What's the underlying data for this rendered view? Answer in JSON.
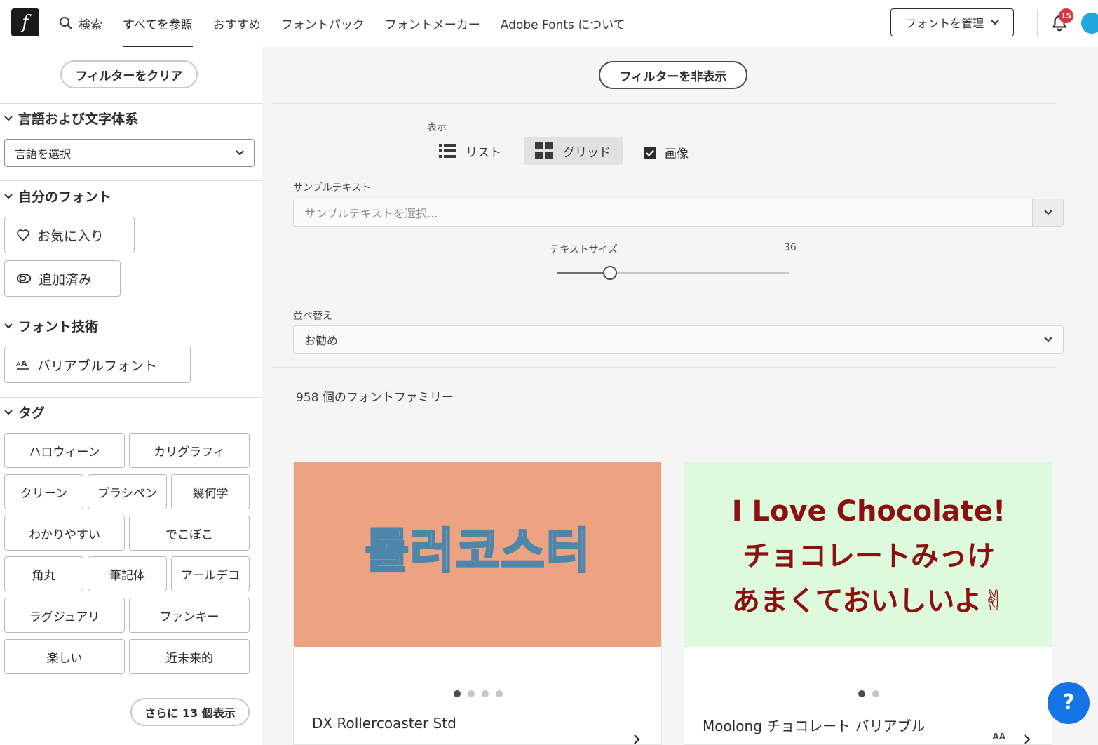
{
  "header": {
    "logo_glyph": "f",
    "nav": {
      "search": "検索",
      "browse_all": "すべてを参照",
      "recommended": "おすすめ",
      "font_packs": "フォントパック",
      "foundries": "フォントメーカー",
      "about": "Adobe Fonts について"
    },
    "manage_fonts": "フォントを管理",
    "notification_count": "15"
  },
  "sidebar": {
    "clear_filters": "フィルターをクリア",
    "language_section": {
      "title": "言語および文字体系",
      "select_value": "言語を選択"
    },
    "my_fonts_section": {
      "title": "自分のフォント",
      "favorites": "お気に入り",
      "added": "追加済み"
    },
    "tech_section": {
      "title": "フォント技術",
      "variable": "バリアブルフォント"
    },
    "tags_section": {
      "title": "タグ",
      "tags": [
        "ハロウィーン",
        "カリグラフィ",
        "クリーン",
        "ブラシペン",
        "幾何学",
        "わかりやすい",
        "でこぼこ",
        "角丸",
        "筆記体",
        "アールデコ",
        "ラグジュアリ",
        "ファンキー",
        "楽しい",
        "近未来的"
      ],
      "show_more": "さらに 13 個表示"
    }
  },
  "main": {
    "hide_filters": "フィルターを非表示",
    "view_label": "表示",
    "view_list": "リスト",
    "view_grid": "グリッド",
    "view_selected": "grid",
    "images_label": "画像",
    "images_checked": true,
    "sample_text_label": "サンプルテキスト",
    "sample_text_placeholder": "サンプルテキストを選択...",
    "text_size_label": "テキストサイズ",
    "text_size_value": "36",
    "text_size_fraction": 0.23,
    "sort_label": "並べ替え",
    "sort_value": "お勧め",
    "family_count": "958 個のフォントファミリー",
    "cards": [
      {
        "name": "DX Rollercoaster Std",
        "preview_text": "롤러코스터",
        "bg_color": "#eda281",
        "text_color": "#4d86ab",
        "dots": 4,
        "active_dot": 0,
        "variable": false
      },
      {
        "name": "Moolong チョコレート バリアブル",
        "preview_lines": [
          "I Love Chocolate!",
          "チョコレートみっけ",
          "あまくておいしいよ✌"
        ],
        "bg_color": "#ddfadd",
        "text_color": "#8b1010",
        "dots": 2,
        "active_dot": 0,
        "variable": true,
        "variable_badge": "AA"
      }
    ]
  },
  "help_glyph": "?",
  "colors": {
    "accent_blue": "#1473e6",
    "badge_red": "#d7373f",
    "avatar": "#22a7dd"
  }
}
